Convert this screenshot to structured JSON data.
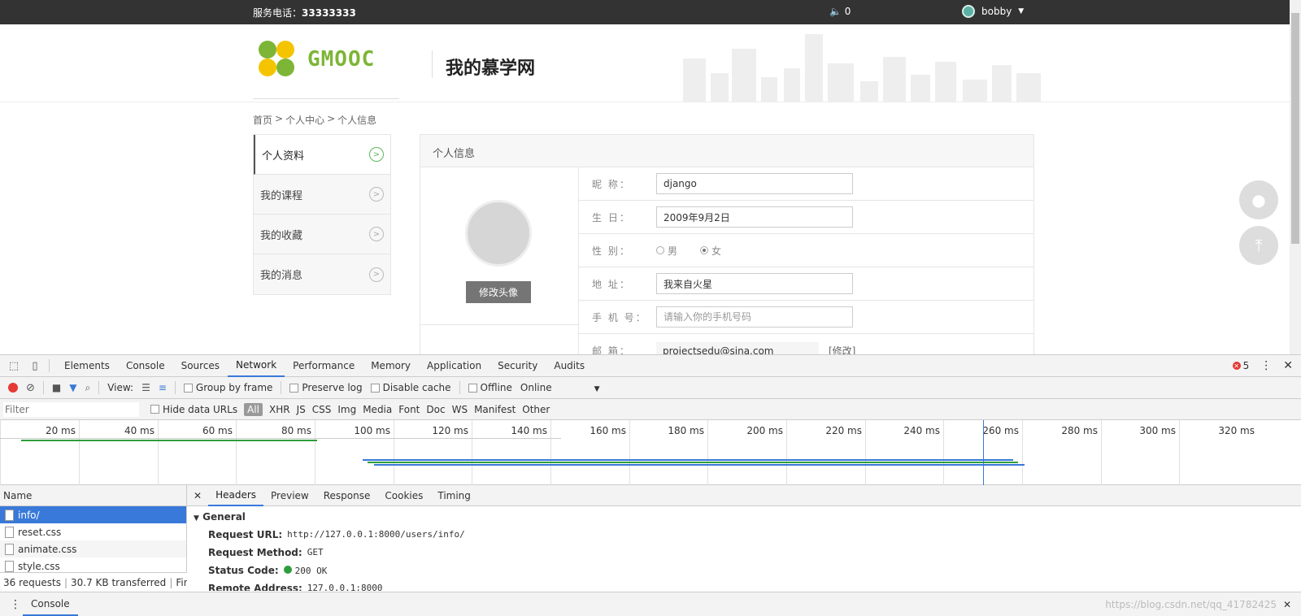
{
  "topbar": {
    "phone_label": "服务电话：",
    "phone_number": "33333333",
    "volume_count": "0",
    "username": "bobby"
  },
  "header": {
    "logo_text": "GMOOC",
    "title": "我的慕学网"
  },
  "breadcrumb": {
    "home": "首页",
    "sep": ">",
    "center": "个人中心",
    "current": "个人信息"
  },
  "sidebar": {
    "items": [
      {
        "label": "个人资料"
      },
      {
        "label": "我的课程"
      },
      {
        "label": "我的收藏"
      },
      {
        "label": "我的消息"
      }
    ]
  },
  "panel": {
    "title": "个人信息",
    "change_avatar": "修改头像",
    "nickname_label": "昵 称：",
    "nickname_value": "django",
    "birthday_label": "生 日：",
    "birthday_value": "2009年9月2日",
    "gender_label": "性 别：",
    "gender_male": "男",
    "gender_female": "女",
    "address_label": "地 址：",
    "address_value": "我来自火星",
    "mobile_label": "手 机 号：",
    "mobile_placeholder": "请输入你的手机号码",
    "email_label": "邮 箱：",
    "email_value": "projectsedu@sina.com",
    "email_modify": "[修改]"
  },
  "devtools": {
    "tabs": [
      "Elements",
      "Console",
      "Sources",
      "Network",
      "Performance",
      "Memory",
      "Application",
      "Security",
      "Audits"
    ],
    "active_tab": "Network",
    "error_count": "5",
    "toolbar": {
      "view_label": "View:",
      "group_by_frame": "Group by frame",
      "preserve_log": "Preserve log",
      "disable_cache": "Disable cache",
      "offline": "Offline",
      "online": "Online"
    },
    "filter": {
      "placeholder": "Filter",
      "hide_data_urls": "Hide data URLs",
      "types": [
        "All",
        "XHR",
        "JS",
        "CSS",
        "Img",
        "Media",
        "Font",
        "Doc",
        "WS",
        "Manifest",
        "Other"
      ]
    },
    "timeline_ticks": [
      "20 ms",
      "40 ms",
      "60 ms",
      "80 ms",
      "100 ms",
      "120 ms",
      "140 ms",
      "160 ms",
      "180 ms",
      "200 ms",
      "220 ms",
      "240 ms",
      "260 ms",
      "280 ms",
      "300 ms",
      "320 ms"
    ],
    "name_header": "Name",
    "requests": [
      "info/",
      "reset.css",
      "animate.css",
      "style.css"
    ],
    "summary": {
      "requests": "36 requests",
      "transferred": "30.7 KB transferred",
      "finish": "Finis..."
    },
    "detail_tabs": [
      "Headers",
      "Preview",
      "Response",
      "Cookies",
      "Timing"
    ],
    "general": {
      "title": "General",
      "request_url_label": "Request URL:",
      "request_url": "http://127.0.0.1:8000/users/info/",
      "method_label": "Request Method:",
      "method": "GET",
      "status_label": "Status Code:",
      "status": "200 OK",
      "remote_label": "Remote Address:",
      "remote": "127.0.0.1:8000"
    },
    "console_tab": "Console",
    "watermark": "https://blog.csdn.net/qq_41782425"
  },
  "colors": {
    "topbar_bg": "#333333",
    "accent_blue": "#3879d9",
    "logo_green": "#7db536",
    "logo_yellow": "#f5c400",
    "status_green": "#2e9e3c",
    "record_red": "#e53935"
  }
}
